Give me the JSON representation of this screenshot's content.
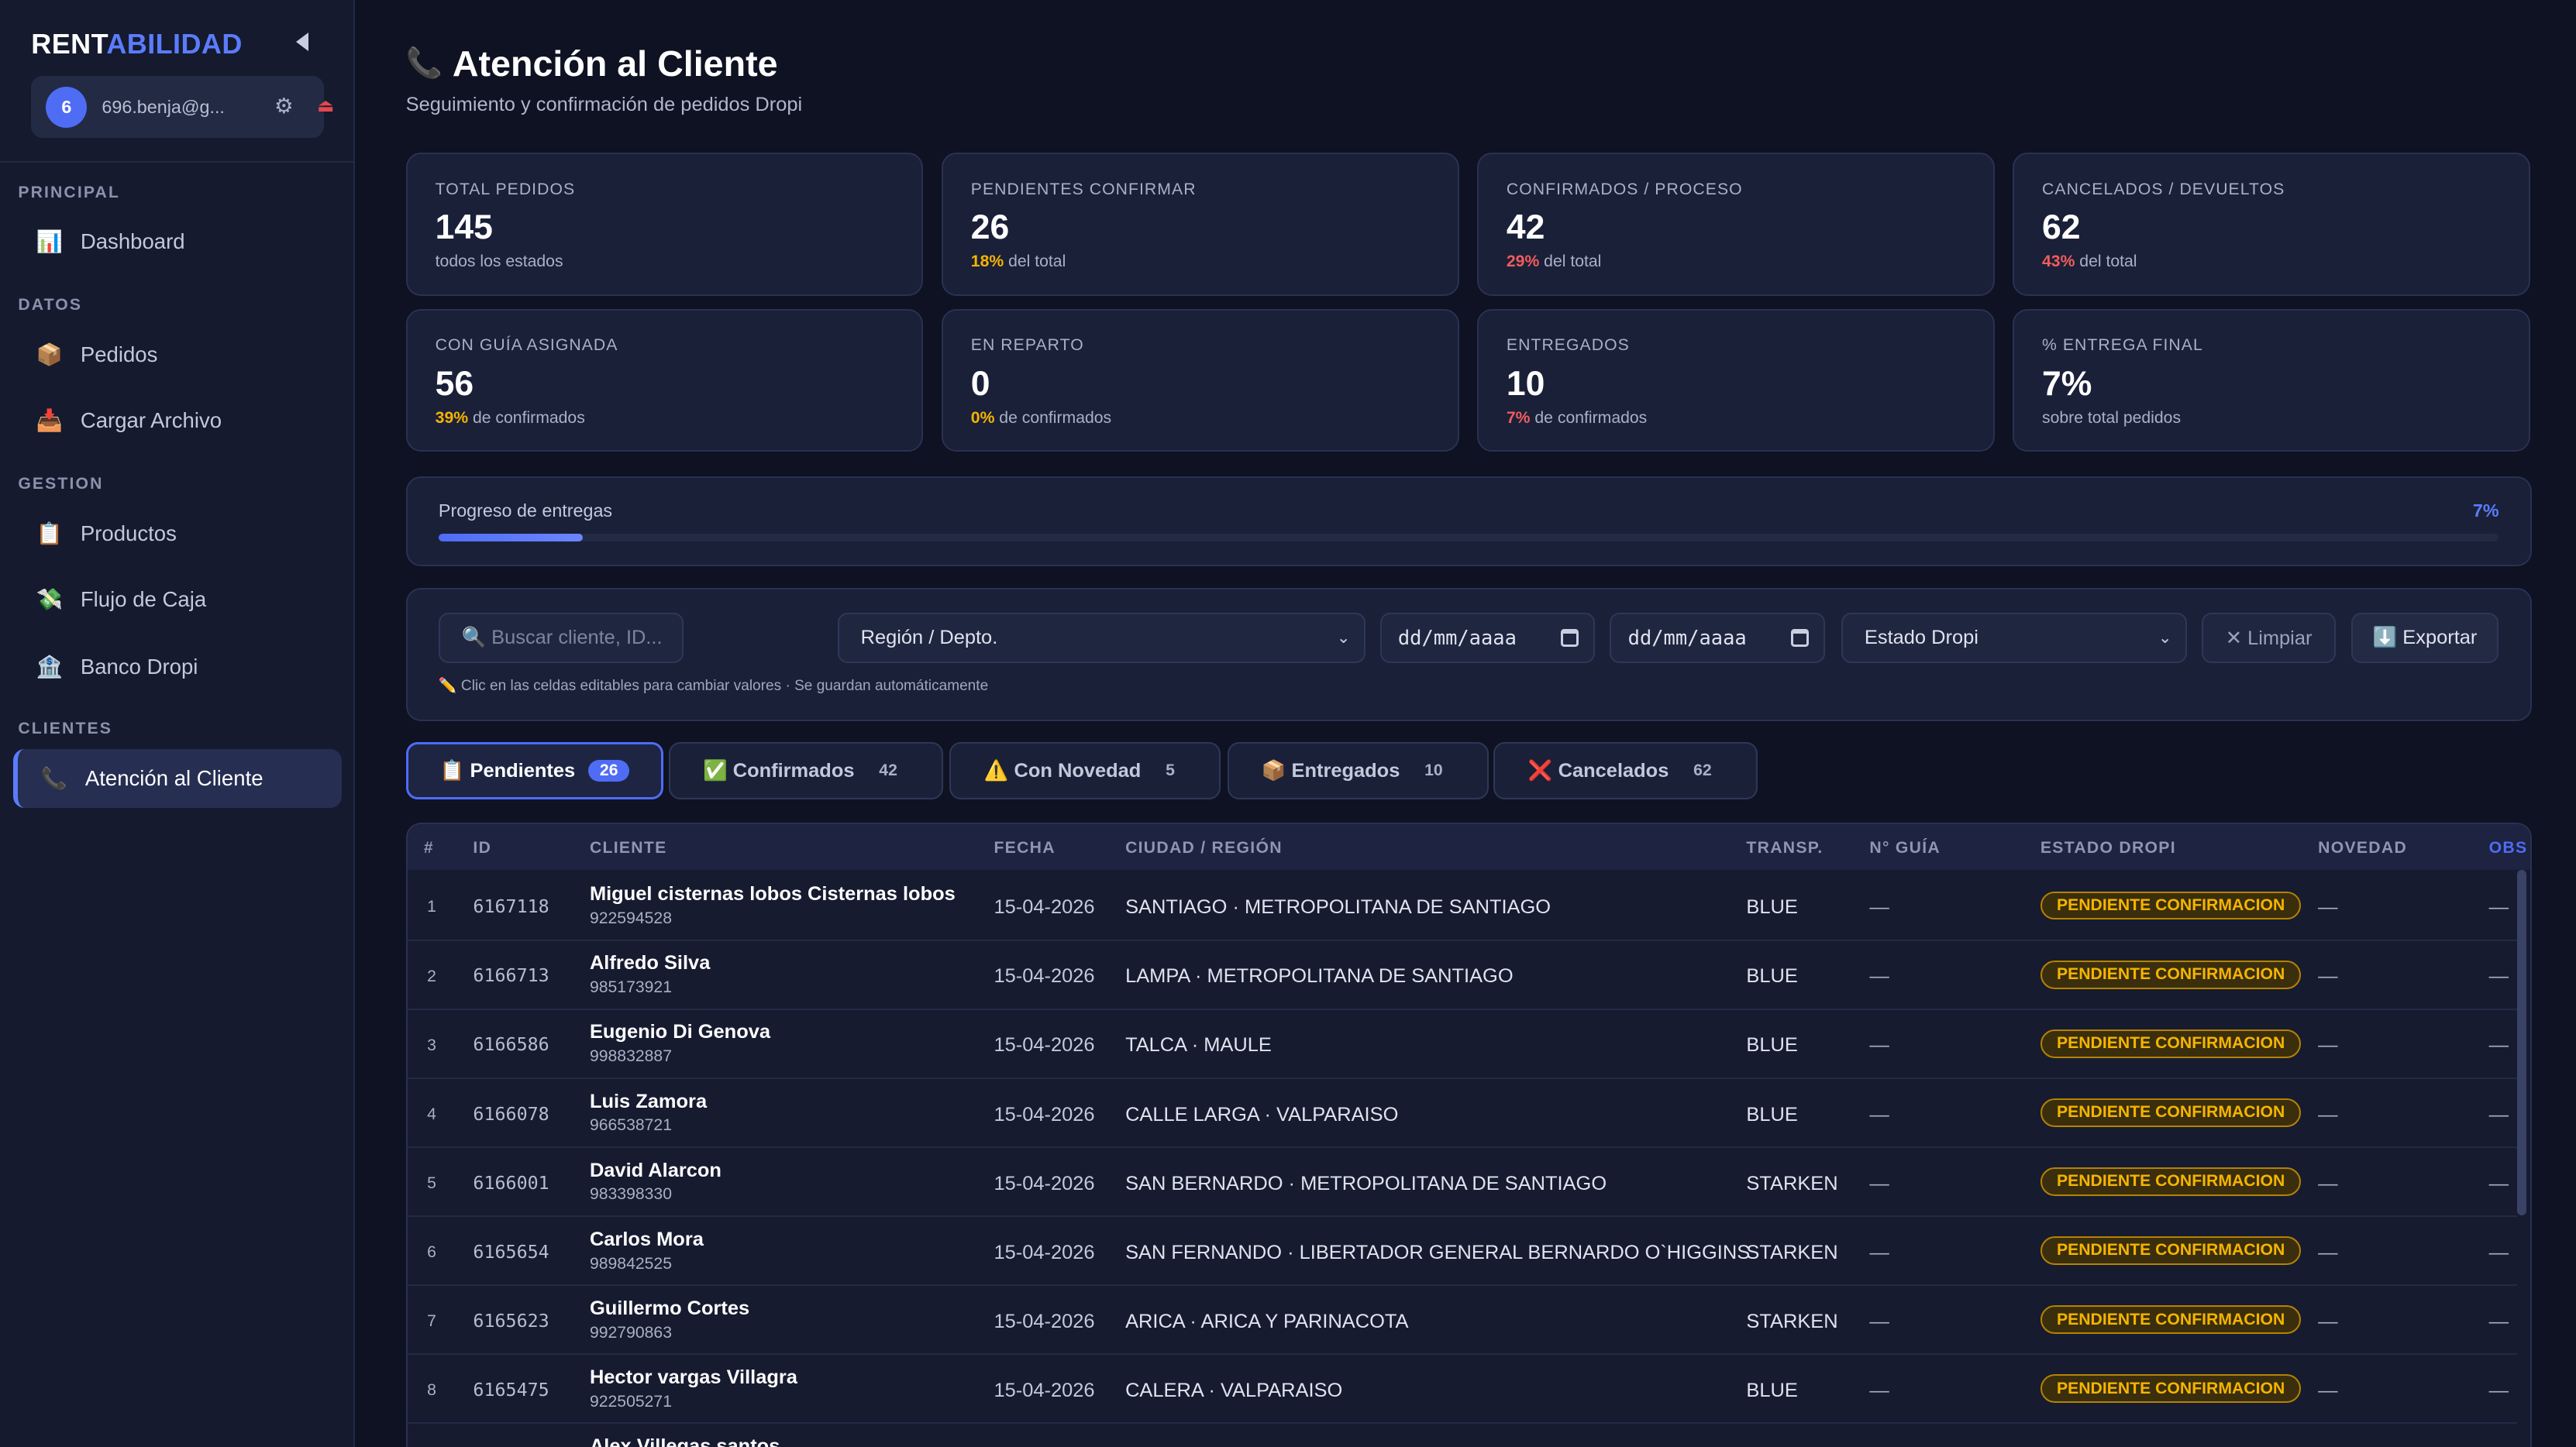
{
  "app": {
    "logo_a": "RENT",
    "logo_b": "ABILIDAD"
  },
  "user": {
    "avatar": "6",
    "email": "696.benja@g..."
  },
  "sidebar": {
    "sections": [
      {
        "label": "PRINCIPAL",
        "items": [
          {
            "icon": "📊",
            "label": "Dashboard"
          }
        ]
      },
      {
        "label": "DATOS",
        "items": [
          {
            "icon": "📦",
            "label": "Pedidos"
          },
          {
            "icon": "📥",
            "label": "Cargar Archivo"
          }
        ]
      },
      {
        "label": "GESTION",
        "items": [
          {
            "icon": "📋",
            "label": "Productos"
          },
          {
            "icon": "💸",
            "label": "Flujo de Caja"
          },
          {
            "icon": "🏦",
            "label": "Banco Dropi"
          }
        ]
      },
      {
        "label": "CLIENTES",
        "items": [
          {
            "icon": "📞",
            "label": "Atención al Cliente",
            "active": true
          }
        ]
      }
    ]
  },
  "page": {
    "icon": "📞",
    "title": "Atención al Cliente",
    "subtitle": "Seguimiento y confirmación de pedidos Dropi"
  },
  "stats": [
    {
      "label": "TOTAL PEDIDOS",
      "value": "145",
      "pct": "",
      "sub": "todos los estados",
      "pct_color": ""
    },
    {
      "label": "PENDIENTES CONFIRMAR",
      "value": "26",
      "pct": "18%",
      "sub": " del total",
      "pct_color": "#f5b400"
    },
    {
      "label": "CONFIRMADOS / PROCESO",
      "value": "42",
      "pct": "29%",
      "sub": " del total",
      "pct_color": "#f25c5c"
    },
    {
      "label": "CANCELADOS / DEVUELTOS",
      "value": "62",
      "pct": "43%",
      "sub": " del total",
      "pct_color": "#f25c5c"
    },
    {
      "label": "CON GUÍA ASIGNADA",
      "value": "56",
      "pct": "39%",
      "sub": " de confirmados",
      "pct_color": "#f5b400"
    },
    {
      "label": "EN REPARTO",
      "value": "0",
      "pct": "0%",
      "sub": " de confirmados",
      "pct_color": "#f5b400"
    },
    {
      "label": "ENTREGADOS",
      "value": "10",
      "pct": "7%",
      "sub": " de confirmados",
      "pct_color": "#f25c5c"
    },
    {
      "label": "% ENTREGA FINAL",
      "value": "7%",
      "pct": "",
      "sub": "sobre total pedidos",
      "pct_color": ""
    }
  ],
  "progress": {
    "label": "Progreso de entregas",
    "value_text": "7%",
    "fraction": 0.07
  },
  "filters": {
    "search_placeholder": "🔍 Buscar cliente, ID...",
    "region": "Región / Depto.",
    "date_from": "dd/mm/aaaa",
    "date_to": "dd/mm/aaaa",
    "estado": "Estado Dropi",
    "clear": "✕ Limpiar",
    "export": "⬇️ Exportar",
    "hint": "✏️ Clic en las celdas editables para cambiar valores · Se guardan automáticamente"
  },
  "tabs": [
    {
      "icon": "📋",
      "label": "Pendientes",
      "count": "26",
      "active": true
    },
    {
      "icon": "✅",
      "label": "Confirmados",
      "count": "42"
    },
    {
      "icon": "⚠️",
      "label": "Con Novedad",
      "count": "5"
    },
    {
      "icon": "📦",
      "label": "Entregados",
      "count": "10"
    },
    {
      "icon": "❌",
      "label": "Cancelados",
      "count": "62"
    }
  ],
  "table": {
    "headers": [
      "#",
      "ID",
      "CLIENTE",
      "FECHA",
      "CIUDAD / REGIÓN",
      "TRANSP.",
      "N° GUÍA",
      "ESTADO DROPI",
      "NOVEDAD",
      "OBS"
    ],
    "rows": [
      {
        "n": "1",
        "id": "6167118",
        "name": "Miguel cisternas lobos Cisternas lobos",
        "phone": "922594528",
        "date": "15-04-2026",
        "city": "SANTIAGO · METROPOLITANA DE SANTIAGO",
        "tr": "BLUE",
        "guia": "—",
        "estado": "PENDIENTE CONFIRMACION",
        "nov": "—",
        "obs": "—"
      },
      {
        "n": "2",
        "id": "6166713",
        "name": "Alfredo Silva",
        "phone": "985173921",
        "date": "15-04-2026",
        "city": "LAMPA · METROPOLITANA DE SANTIAGO",
        "tr": "BLUE",
        "guia": "—",
        "estado": "PENDIENTE CONFIRMACION",
        "nov": "—",
        "obs": "—"
      },
      {
        "n": "3",
        "id": "6166586",
        "name": "Eugenio Di Genova",
        "phone": "998832887",
        "date": "15-04-2026",
        "city": "TALCA · MAULE",
        "tr": "BLUE",
        "guia": "—",
        "estado": "PENDIENTE CONFIRMACION",
        "nov": "—",
        "obs": "—"
      },
      {
        "n": "4",
        "id": "6166078",
        "name": "Luis Zamora",
        "phone": "966538721",
        "date": "15-04-2026",
        "city": "CALLE LARGA · VALPARAISO",
        "tr": "BLUE",
        "guia": "—",
        "estado": "PENDIENTE CONFIRMACION",
        "nov": "—",
        "obs": "—"
      },
      {
        "n": "5",
        "id": "6166001",
        "name": "David Alarcon",
        "phone": "983398330",
        "date": "15-04-2026",
        "city": "SAN BERNARDO · METROPOLITANA DE SANTIAGO",
        "tr": "STARKEN",
        "guia": "—",
        "estado": "PENDIENTE CONFIRMACION",
        "nov": "—",
        "obs": "—"
      },
      {
        "n": "6",
        "id": "6165654",
        "name": "Carlos Mora",
        "phone": "989842525",
        "date": "15-04-2026",
        "city": "SAN FERNANDO · LIBERTADOR GENERAL BERNARDO O`HIGGINS",
        "tr": "STARKEN",
        "guia": "—",
        "estado": "PENDIENTE CONFIRMACION",
        "nov": "—",
        "obs": "—"
      },
      {
        "n": "7",
        "id": "6165623",
        "name": "Guillermo Cortes",
        "phone": "992790863",
        "date": "15-04-2026",
        "city": "ARICA · ARICA Y PARINACOTA",
        "tr": "STARKEN",
        "guia": "—",
        "estado": "PENDIENTE CONFIRMACION",
        "nov": "—",
        "obs": "—"
      },
      {
        "n": "8",
        "id": "6165475",
        "name": "Hector vargas Villagra",
        "phone": "922505271",
        "date": "15-04-2026",
        "city": "CALERA · VALPARAISO",
        "tr": "BLUE",
        "guia": "—",
        "estado": "PENDIENTE CONFIRMACION",
        "nov": "—",
        "obs": "—"
      },
      {
        "n": "",
        "id": "",
        "name": "Alex Villegas santos",
        "phone": "",
        "date": "",
        "city": "",
        "tr": "",
        "guia": "",
        "estado": "",
        "nov": "",
        "obs": ""
      }
    ]
  }
}
